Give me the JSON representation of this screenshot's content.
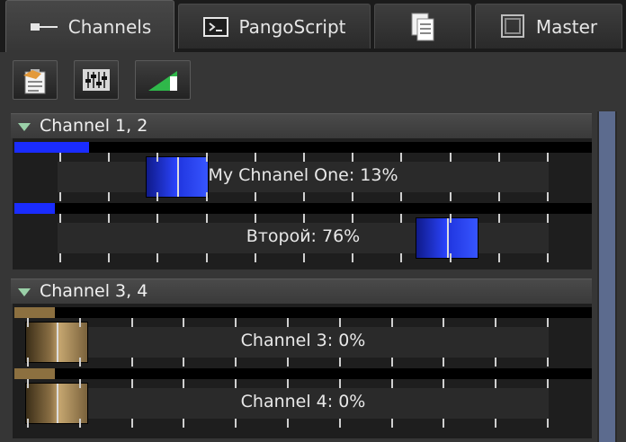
{
  "tabs": [
    {
      "label": "Channels",
      "icon": "plug-icon",
      "active": true
    },
    {
      "label": "PangoScript",
      "icon": "terminal-icon",
      "active": false
    },
    {
      "label": "",
      "icon": "copy-pages-icon",
      "active": false
    },
    {
      "label": "Master",
      "icon": "master-window-icon",
      "active": false
    }
  ],
  "toolbar": [
    {
      "icon": "clipboard-handshake-icon"
    },
    {
      "icon": "mixer-faders-icon"
    },
    {
      "icon": "ramp-signal-icon"
    }
  ],
  "groups": [
    {
      "title": "Channel 1, 2",
      "channels": [
        {
          "label": "My Chnanel One: 13%",
          "level": 0.13,
          "knob": 0.13,
          "style": "blue"
        },
        {
          "label": "Второй: 76%",
          "level": 0.07,
          "knob": 0.76,
          "style": "blue"
        }
      ]
    },
    {
      "title": "Channel 3, 4",
      "channels": [
        {
          "label": "Channel 3: 0%",
          "level": 0.07,
          "knob": 0.0,
          "style": "gold"
        },
        {
          "label": "Channel 4: 0%",
          "level": 0.07,
          "knob": 0.0,
          "style": "gold"
        }
      ]
    }
  ],
  "colors": {
    "level_blue": "#1a2cff",
    "level_gold": "#8c7040",
    "scrollbar": "#5c6b8e"
  }
}
